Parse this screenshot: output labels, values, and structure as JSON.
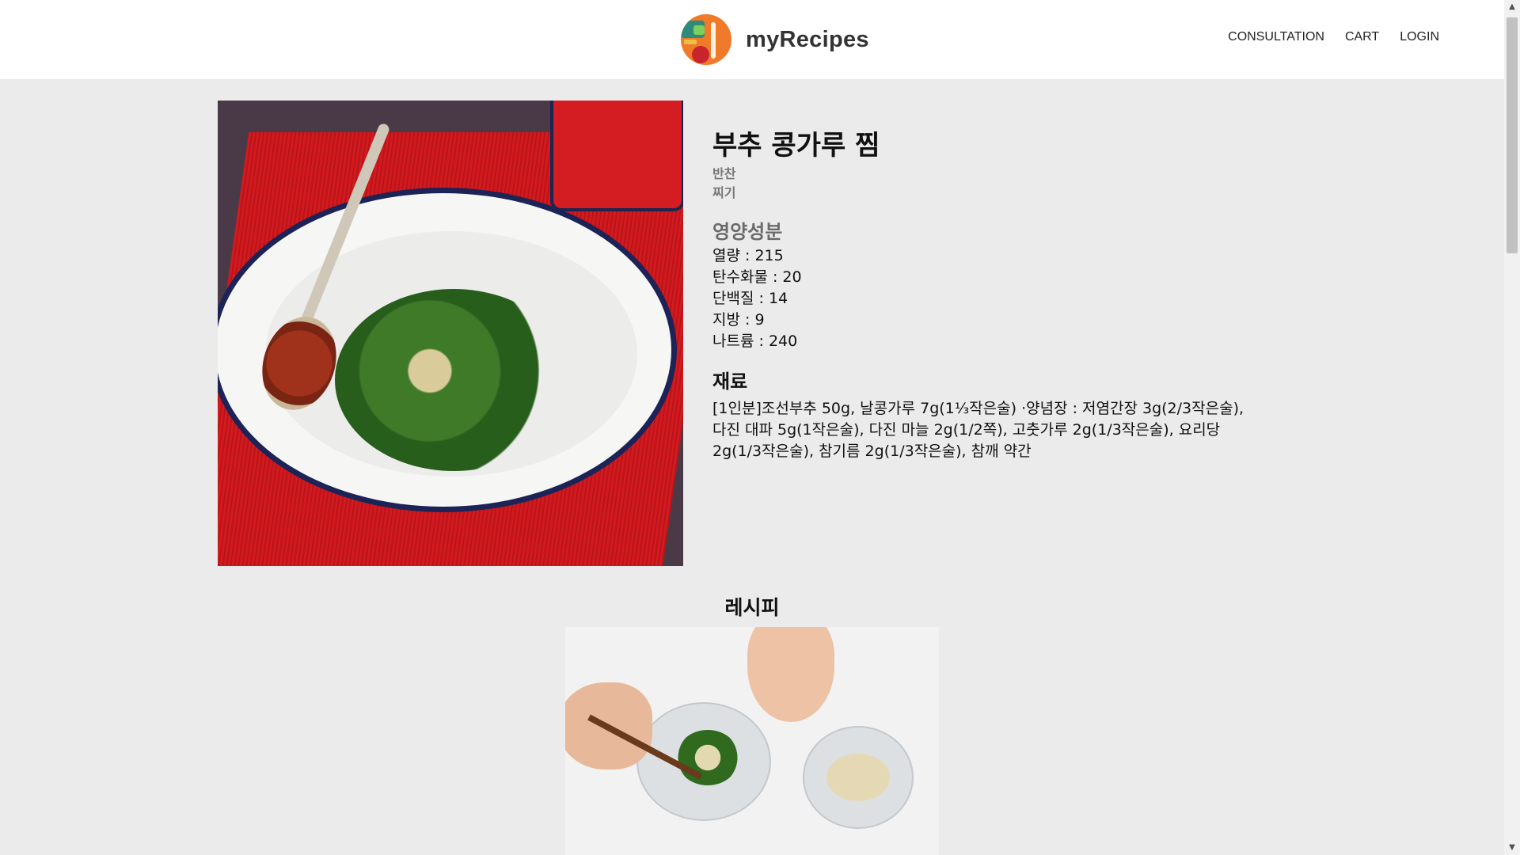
{
  "header": {
    "brand": "myRecipes",
    "nav": [
      "CONSULTATION",
      "CART",
      "LOGIN"
    ]
  },
  "recipe": {
    "title": "부추 콩가루 찜",
    "category": "반찬",
    "method": "찌기",
    "nutrition_heading": "영양성분",
    "nutrition": [
      {
        "label": "열량",
        "value": "215"
      },
      {
        "label": "탄수화물",
        "value": "20"
      },
      {
        "label": "단백질",
        "value": "14"
      },
      {
        "label": "지방",
        "value": "9"
      },
      {
        "label": "나트륨",
        "value": "240"
      }
    ],
    "ingredients_heading": "재료",
    "ingredients": "[1인분]조선부추 50g, 날콩가루 7g(1⅓작은술) ·양념장 : 저염간장 3g(2/3작은술), 다진 대파 5g(1작은술), 다진 마늘 2g(1/2쪽), 고춧가루 2g(1/3작은술), 요리당 2g(1/3작은술), 참기름 2g(1/3작은술), 참깨 약간",
    "steps_heading": "레시피"
  },
  "scrollbar": {
    "up_icon": "▲",
    "down_icon": "▼"
  },
  "colors": {
    "header_bg": "#ffffff",
    "page_bg": "#ebebeb"
  }
}
